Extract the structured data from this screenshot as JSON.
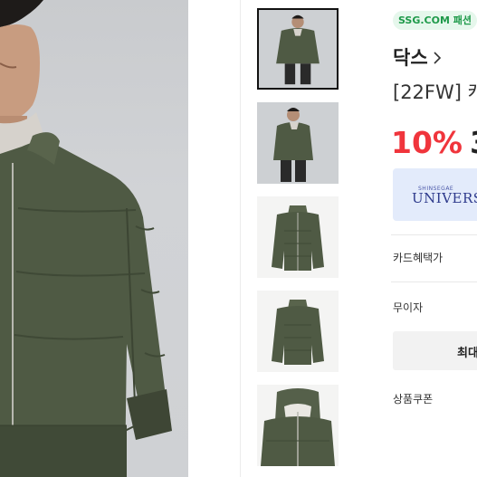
{
  "store_badge": "SSG.COM 패션",
  "brand": {
    "name": "닥스",
    "chevron_icon": "chevron-right-icon"
  },
  "product": {
    "title": "[22FW] 캐"
  },
  "price": {
    "discount": "10%",
    "amount": "3"
  },
  "universe": {
    "small_text": "SHINSEGAE",
    "logo_text": "UNIVERSE"
  },
  "benefits": {
    "card": "카드혜택가",
    "interest_free": "무이자",
    "max_button": "최대",
    "coupon": "상품쿠폰"
  },
  "colors": {
    "jacket": "#4f5a44",
    "background": "#cfd1d4",
    "discount": "#f0353c",
    "badge_text": "#1f9a4a",
    "badge_bg": "#e6f7ec",
    "universe_bg": "#e3ebfb"
  },
  "thumbnails": [
    {
      "name": "thumb-model-front",
      "active": true
    },
    {
      "name": "thumb-model-angle",
      "active": false
    },
    {
      "name": "thumb-jacket-front",
      "active": false
    },
    {
      "name": "thumb-jacket-back",
      "active": false
    },
    {
      "name": "thumb-collar-detail",
      "active": false
    }
  ]
}
